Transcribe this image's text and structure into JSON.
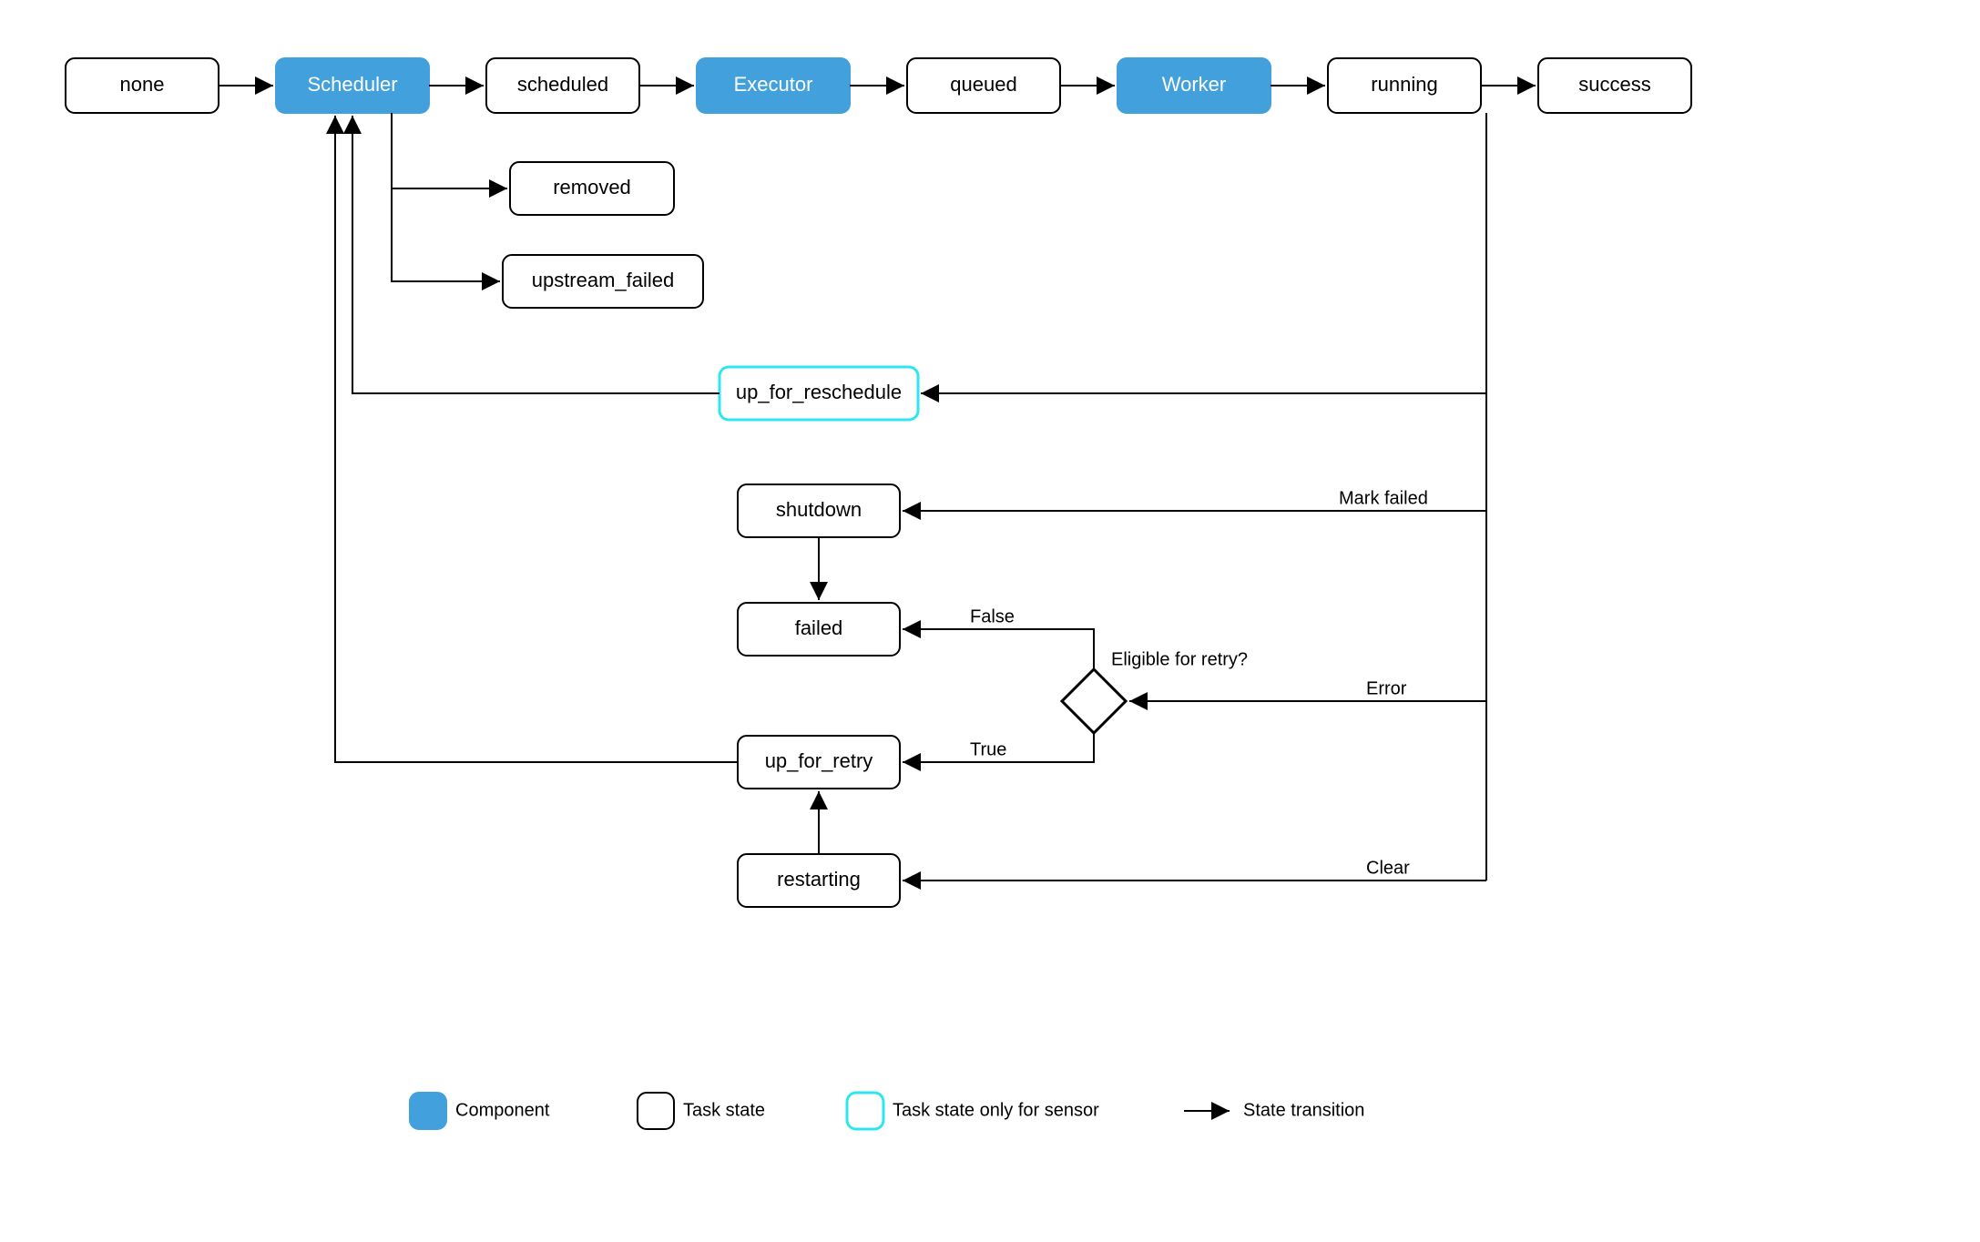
{
  "nodes": {
    "none": "none",
    "scheduler": "Scheduler",
    "scheduled": "scheduled",
    "executor": "Executor",
    "queued": "queued",
    "worker": "Worker",
    "running": "running",
    "success": "success",
    "removed": "removed",
    "upstream_failed": "upstream_failed",
    "up_for_reschedule": "up_for_reschedule",
    "shutdown": "shutdown",
    "failed": "failed",
    "up_for_retry": "up_for_retry",
    "restarting": "restarting"
  },
  "edge_labels": {
    "mark_failed": "Mark failed",
    "false": "False",
    "true": "True",
    "eligible": "Eligible for retry?",
    "error": "Error",
    "clear": "Clear"
  },
  "legend": {
    "component": "Component",
    "task_state": "Task state",
    "sensor": "Task state only for sensor",
    "transition": "State transition"
  }
}
